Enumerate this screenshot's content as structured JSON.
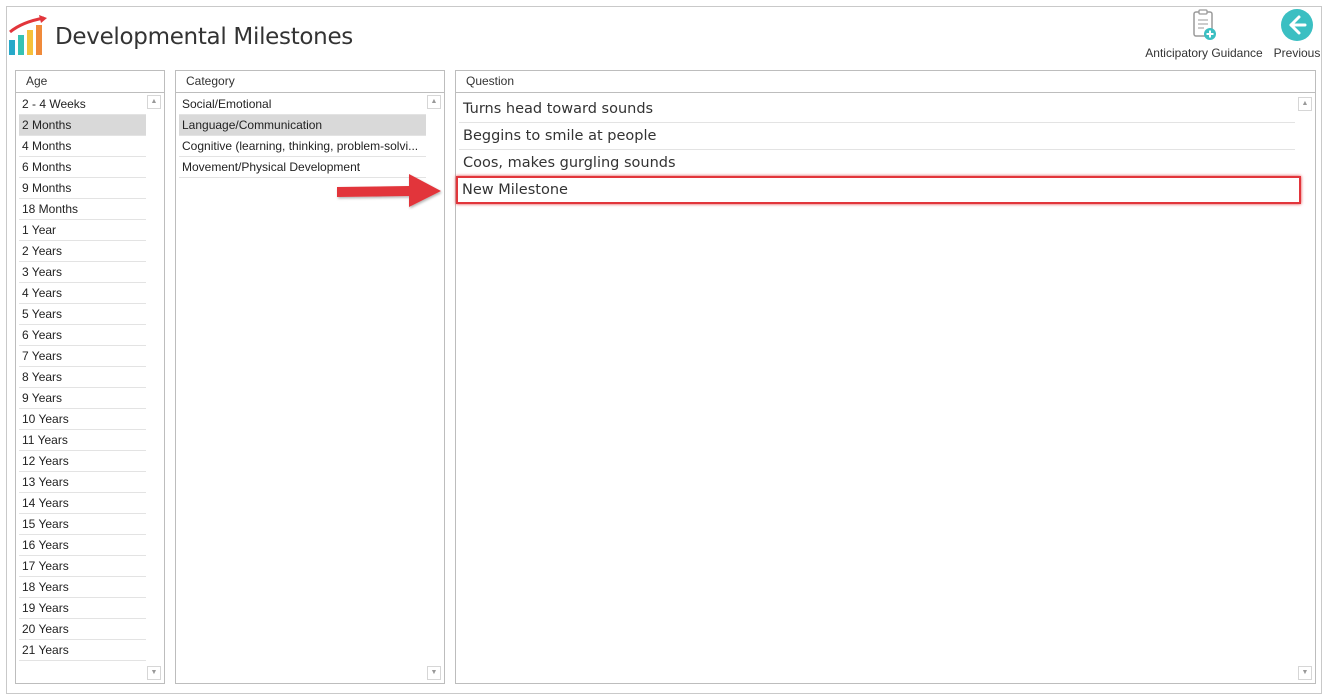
{
  "header": {
    "title": "Developmental Milestones",
    "anticipatory_label": "Anticipatory Guidance",
    "previous_label": "Previous"
  },
  "panels": {
    "age_header": "Age",
    "category_header": "Category",
    "question_header": "Question"
  },
  "ages": [
    "2 - 4 Weeks",
    "2 Months",
    "4 Months",
    "6 Months",
    "9 Months",
    "18 Months",
    "1 Year",
    "2 Years",
    "3 Years",
    "4 Years",
    "5 Years",
    "6 Years",
    "7 Years",
    "8 Years",
    "9 Years",
    "10 Years",
    "11 Years",
    "12 Years",
    "13 Years",
    "14 Years",
    "15 Years",
    "16 Years",
    "17 Years",
    "18 Years",
    "19 Years",
    "20 Years",
    "21 Years"
  ],
  "ages_selected": "2 Months",
  "categories": [
    "Social/Emotional",
    "Language/Communication",
    "Cognitive (learning, thinking, problem-solvi...",
    "Movement/Physical Development"
  ],
  "category_selected": "Language/Communication",
  "questions": [
    "Turns head toward sounds",
    "Beggins to smile at people",
    "Coos, makes gurgling sounds",
    "New Milestone"
  ],
  "colors": {
    "selection": "#d9d9d9",
    "highlight": "#e2353b",
    "accent_teal": "#3bbfc2"
  }
}
